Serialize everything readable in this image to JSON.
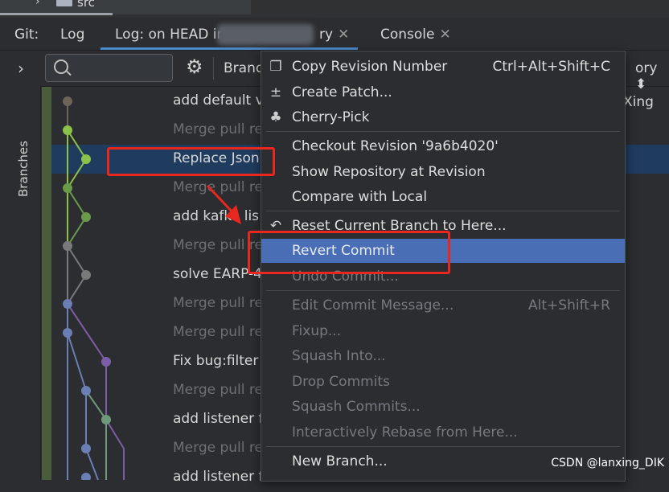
{
  "top": {
    "folder_label": "src"
  },
  "tabs": {
    "git_label": "Git:",
    "items": [
      {
        "label": "Log"
      },
      {
        "label": "Log: on HEAD in",
        "suffix": "ry"
      },
      {
        "label": "Console"
      }
    ]
  },
  "sidebar": {
    "branches_label": "Branches"
  },
  "toolbar": {
    "branch_label": "Branc",
    "story_label": "ory"
  },
  "log": {
    "rows": [
      {
        "message": "add default v",
        "muted": false
      },
      {
        "message": "Merge pull re",
        "muted": true
      },
      {
        "message": "Replace Json",
        "muted": false,
        "selected": true
      },
      {
        "message": "Merge pull re",
        "muted": true
      },
      {
        "message": "add kafka lis",
        "muted": false
      },
      {
        "message": "Merge pull re",
        "muted": true
      },
      {
        "message": "solve EARP-4",
        "muted": false
      },
      {
        "message": "Merge pull re",
        "muted": true
      },
      {
        "message": "Merge pull re",
        "muted": true
      },
      {
        "message": "Fix bug:filter",
        "muted": false
      },
      {
        "message": "Merge pull re",
        "muted": true
      },
      {
        "message": "add listener f",
        "muted": false
      },
      {
        "message": "Merge pull re",
        "muted": true
      },
      {
        "message": "add listener f",
        "muted": false
      }
    ],
    "author_fragment": "Xing"
  },
  "context_menu": {
    "items": [
      {
        "label": "Copy Revision Number",
        "shortcut": "Ctrl+Alt+Shift+C",
        "icon": "copy-icon",
        "enabled": true
      },
      {
        "label": "Create Patch...",
        "shortcut": "",
        "icon": "patch-icon",
        "enabled": true
      },
      {
        "label": "Cherry-Pick",
        "shortcut": "",
        "icon": "cherry-icon",
        "enabled": true
      },
      {
        "label": "Checkout Revision '9a6b4020'",
        "shortcut": "",
        "enabled": true
      },
      {
        "label": "Show Repository at Revision",
        "shortcut": "",
        "enabled": true
      },
      {
        "label": "Compare with Local",
        "shortcut": "",
        "enabled": true
      },
      {
        "label": "Reset Current Branch to Here...",
        "shortcut": "",
        "icon": "undo-icon",
        "enabled": true
      },
      {
        "label": "Revert Commit",
        "shortcut": "",
        "enabled": true,
        "highlighted": true
      },
      {
        "label": "Undo Commit...",
        "shortcut": "",
        "enabled": false
      },
      {
        "label": "Edit Commit Message...",
        "shortcut": "Alt+Shift+R",
        "enabled": false
      },
      {
        "label": "Fixup...",
        "shortcut": "",
        "enabled": false
      },
      {
        "label": "Squash Into...",
        "shortcut": "",
        "enabled": false
      },
      {
        "label": "Drop Commits",
        "shortcut": "",
        "enabled": false
      },
      {
        "label": "Squash Commits...",
        "shortcut": "",
        "enabled": false
      },
      {
        "label": "Interactively Rebase from Here...",
        "shortcut": "",
        "enabled": false
      },
      {
        "label": "New Branch...",
        "shortcut": "",
        "enabled": true
      }
    ]
  },
  "watermark": "CSDN @lanxing_DIK",
  "colors": {
    "selection": "#1f3b5e",
    "menu_highlight": "#4a6eb5",
    "annotation_red": "#e8281e",
    "graph_green": "#8bc34a",
    "graph_purple": "#7b5ea7",
    "graph_blue": "#6b7fb5"
  }
}
